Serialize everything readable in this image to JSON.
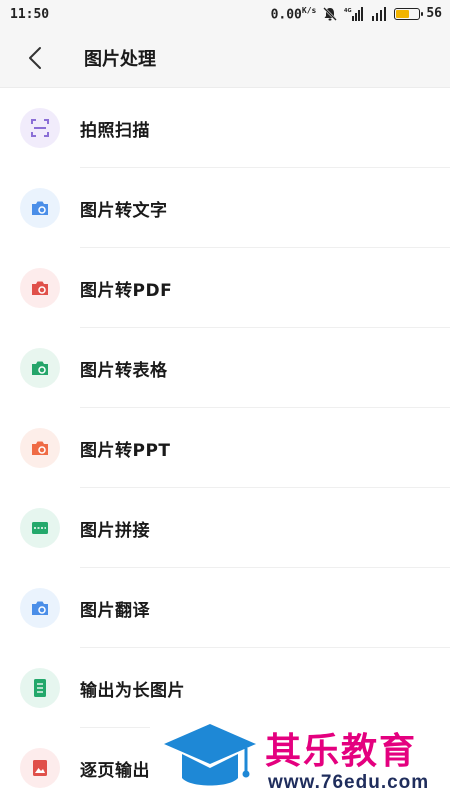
{
  "status_bar": {
    "time": "11:50",
    "net_speed": "0.00",
    "net_unit": "K/s",
    "battery_level": "56",
    "battery_color": "#f2b400"
  },
  "header": {
    "title": "图片处理",
    "back_icon": "chevron-left-icon"
  },
  "menu": [
    {
      "label": "拍照扫描",
      "icon": "scan-icon",
      "bg": "#f1ecfb",
      "fg": "#8b6fd6"
    },
    {
      "label": "图片转文字",
      "icon": "camera-text-icon",
      "bg": "#eaf3fd",
      "fg": "#4a8ee8"
    },
    {
      "label": "图片转PDF",
      "icon": "camera-pdf-icon",
      "bg": "#fdecec",
      "fg": "#e0504a"
    },
    {
      "label": "图片转表格",
      "icon": "camera-table-icon",
      "bg": "#e8f6ef",
      "fg": "#25a56a"
    },
    {
      "label": "图片转PPT",
      "icon": "camera-ppt-icon",
      "bg": "#fdeee9",
      "fg": "#ef6b45"
    },
    {
      "label": "图片拼接",
      "icon": "image-stitch-icon",
      "bg": "#e6f6ef",
      "fg": "#23a86b"
    },
    {
      "label": "图片翻译",
      "icon": "camera-translate-icon",
      "bg": "#eaf3fd",
      "fg": "#4a8ee8"
    },
    {
      "label": "输出为长图片",
      "icon": "long-image-icon",
      "bg": "#e6f6ef",
      "fg": "#23a86b"
    },
    {
      "label": "逐页输出",
      "icon": "page-image-icon",
      "bg": "#fdecec",
      "fg": "#e0504a"
    }
  ],
  "watermark": {
    "title": "其乐教育",
    "url": "www.76edu.com"
  }
}
